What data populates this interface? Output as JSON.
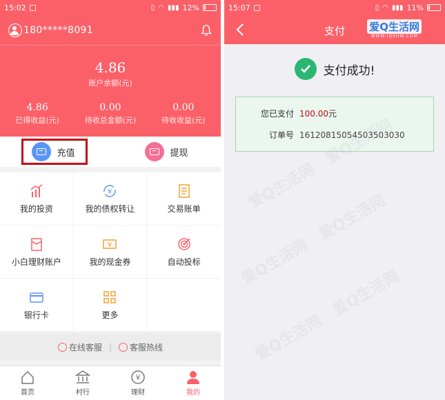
{
  "left": {
    "status": {
      "time": "15:02",
      "battery": "12%",
      "battery_level": 0.12
    },
    "user": {
      "phone": "180*****8091"
    },
    "balance": {
      "value": "4.86",
      "label": "账户余额(元)"
    },
    "stats": [
      {
        "value": "4.86",
        "label": "已得收益(元)"
      },
      {
        "value": "0.00",
        "label": "待收总金额(元)"
      },
      {
        "value": "0.00",
        "label": "待收收益(元)"
      }
    ],
    "actions": {
      "recharge": "充值",
      "withdraw": "提现"
    },
    "grid": [
      {
        "label": "我的投资",
        "icon": "investment-chart-icon"
      },
      {
        "label": "我的债权转让",
        "icon": "yen-transfer-icon"
      },
      {
        "label": "交易账单",
        "icon": "bill-icon"
      },
      {
        "label": "小白理财账户",
        "icon": "wallet-icon"
      },
      {
        "label": "我的现金券",
        "icon": "yen-voucher-icon"
      },
      {
        "label": "自动投标",
        "icon": "target-icon"
      },
      {
        "label": "银行卡",
        "icon": "bank-card-icon"
      },
      {
        "label": "更多",
        "icon": "more-grid-icon"
      }
    ],
    "service": {
      "online": "在线客服",
      "hotline": "客服热线"
    },
    "tabs": [
      {
        "label": "首页",
        "icon": "home-icon"
      },
      {
        "label": "村行",
        "icon": "bank-icon"
      },
      {
        "label": "理财",
        "icon": "yen-circle-icon"
      },
      {
        "label": "我的",
        "icon": "person-icon"
      }
    ],
    "colors": {
      "brand": "#fb6068",
      "highlight_box": "#c00b15"
    }
  },
  "right": {
    "status": {
      "time": "15:07",
      "battery": "11%",
      "battery_level": 0.11
    },
    "nav": {
      "title": "支付",
      "brand_logo": "爱Q生活网",
      "brand_url": "WWW.IQSHW.COM"
    },
    "success_text": "支付成功!",
    "receipt": {
      "paid_label": "您已支付",
      "paid_amount": "100.00",
      "paid_unit": "元",
      "order_label": "订单号",
      "order_no": "16120815054503503030"
    },
    "colors": {
      "success": "#2bb673",
      "amount": "#c00b15"
    }
  }
}
